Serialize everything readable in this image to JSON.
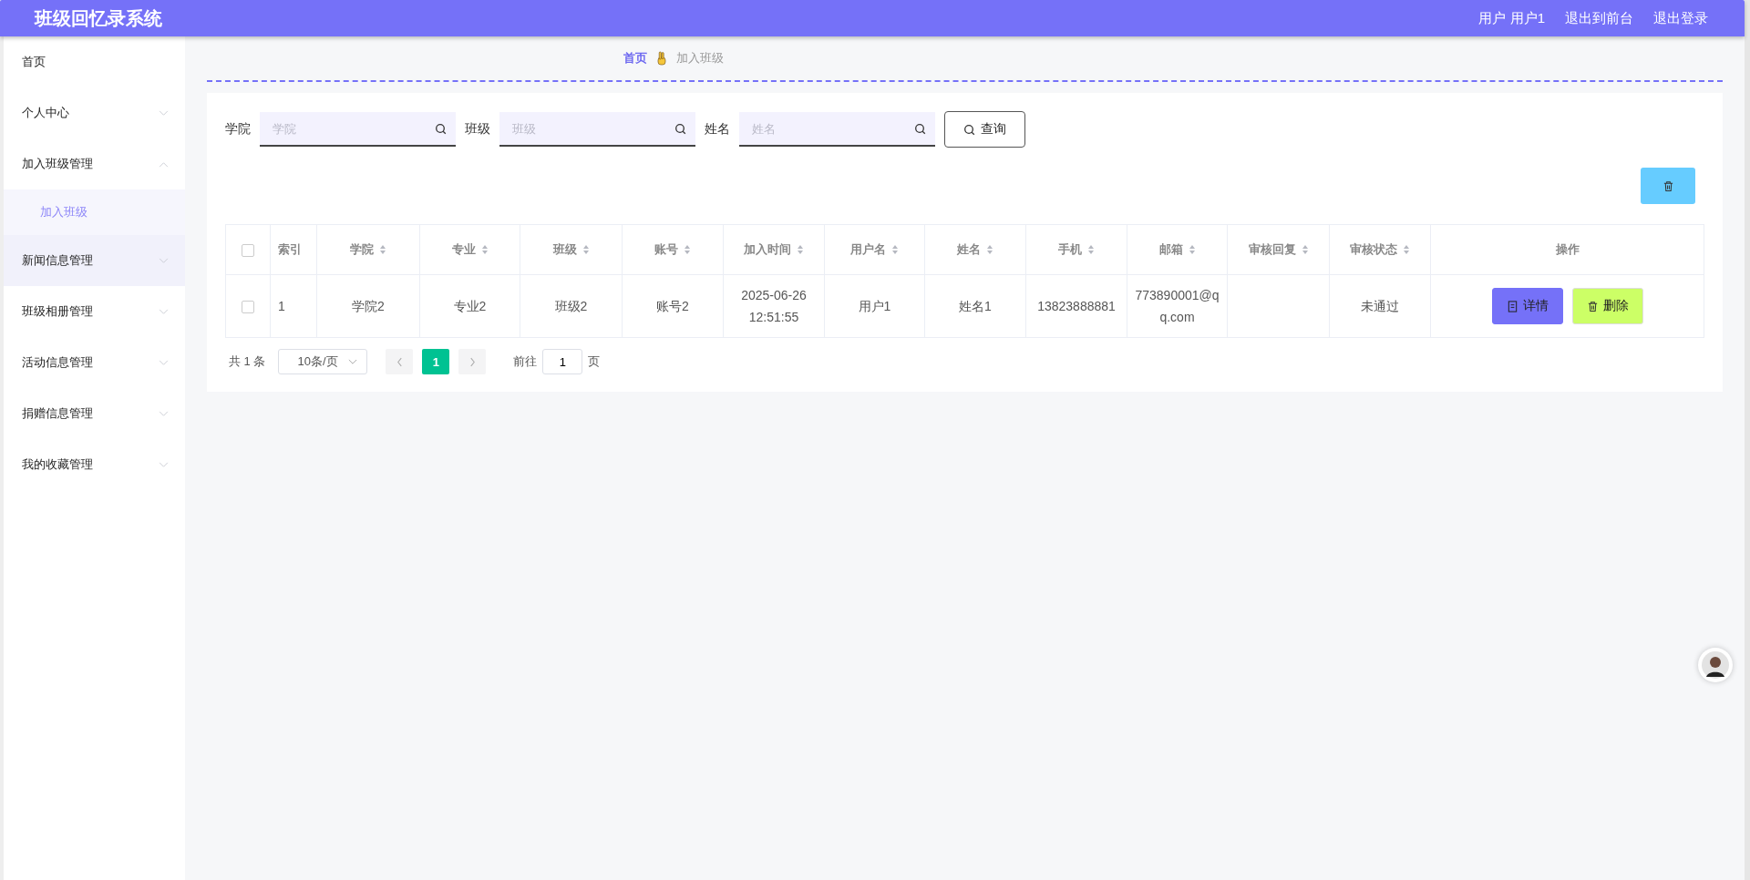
{
  "header": {
    "title": "班级回忆录系统",
    "user": "用户 用户1",
    "links": [
      "退出到前台",
      "退出登录"
    ]
  },
  "sidebar": {
    "items": [
      {
        "label": "首页",
        "kind": "link",
        "hovered": false
      },
      {
        "label": "个人中心",
        "kind": "group",
        "expanded": false,
        "hovered": false
      },
      {
        "label": "加入班级管理",
        "kind": "group",
        "expanded": true,
        "hovered": false,
        "children": [
          {
            "label": "加入班级",
            "selected": true
          }
        ]
      },
      {
        "label": "新闻信息管理",
        "kind": "group",
        "expanded": false,
        "hovered": true
      },
      {
        "label": "班级相册管理",
        "kind": "group",
        "expanded": false,
        "hovered": false
      },
      {
        "label": "活动信息管理",
        "kind": "group",
        "expanded": false,
        "hovered": false
      },
      {
        "label": "捐赠信息管理",
        "kind": "group",
        "expanded": false,
        "hovered": false
      },
      {
        "label": "我的收藏管理",
        "kind": "group",
        "expanded": false,
        "hovered": false
      }
    ]
  },
  "breadcrumb": [
    {
      "label": "首页",
      "current": false
    },
    {
      "label": "加入班级",
      "current": true
    }
  ],
  "search": {
    "fields": [
      {
        "label": "学院",
        "placeholder": "学院"
      },
      {
        "label": "班级",
        "placeholder": "班级"
      },
      {
        "label": "姓名",
        "placeholder": "姓名"
      }
    ],
    "button": "查询"
  },
  "table": {
    "select_all": {
      "checked": false
    },
    "columns": [
      {
        "label": "索引",
        "sortable": false
      },
      {
        "label": "学院",
        "sortable": true
      },
      {
        "label": "专业",
        "sortable": true
      },
      {
        "label": "班级",
        "sortable": true
      },
      {
        "label": "账号",
        "sortable": true
      },
      {
        "label": "加入时间",
        "sortable": true
      },
      {
        "label": "用户名",
        "sortable": true
      },
      {
        "label": "姓名",
        "sortable": true
      },
      {
        "label": "手机",
        "sortable": true
      },
      {
        "label": "邮箱",
        "sortable": true
      },
      {
        "label": "审核回复",
        "sortable": true
      },
      {
        "label": "审核状态",
        "sortable": true
      },
      {
        "label": "操作",
        "sortable": false
      }
    ],
    "rows": [
      {
        "checked": false,
        "cells": [
          "1",
          "学院2",
          "专业2",
          "班级2",
          "账号2",
          "2025-06-26 12:51:55",
          "用户1",
          "姓名1",
          "13823888881",
          "773890001@qq.com",
          "",
          "未通过"
        ],
        "actions": [
          {
            "label": "详情",
            "kind": "detail"
          },
          {
            "label": "删除",
            "kind": "delete"
          }
        ]
      }
    ]
  },
  "pagination": {
    "total": "共 1 条",
    "page_size": "10条/页",
    "pages": [
      {
        "label": "1",
        "selected": true
      }
    ],
    "goto_label": "前往",
    "goto_value": "1",
    "goto_suffix": "页"
  }
}
